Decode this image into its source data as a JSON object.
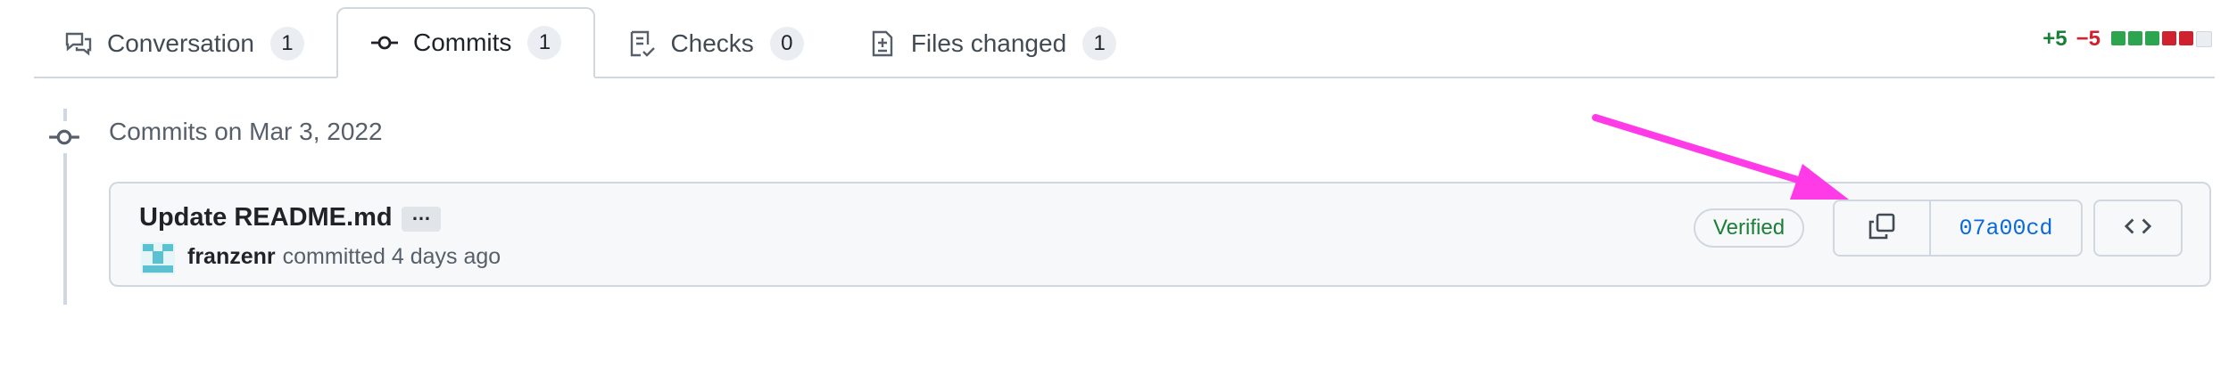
{
  "tabs": [
    {
      "label": "Conversation",
      "count": "1",
      "icon": "comment-discussion-icon"
    },
    {
      "label": "Commits",
      "count": "1",
      "icon": "git-commit-icon"
    },
    {
      "label": "Checks",
      "count": "0",
      "icon": "checklist-icon"
    },
    {
      "label": "Files changed",
      "count": "1",
      "icon": "file-diff-icon"
    }
  ],
  "diffstat": {
    "additions": "+5",
    "deletions": "−5",
    "blocks": [
      "#2da44e",
      "#2da44e",
      "#2da44e",
      "#cf222e",
      "#cf222e",
      "#eaeef2"
    ]
  },
  "group": {
    "title": "Commits on Mar 3, 2022"
  },
  "commit": {
    "message": "Update README.md",
    "ellipsis": "…",
    "author": "franzenr",
    "action": "committed 4 days ago",
    "verified": "Verified",
    "sha": "07a00cd"
  },
  "annotation": {
    "color": "#ff3be8"
  }
}
